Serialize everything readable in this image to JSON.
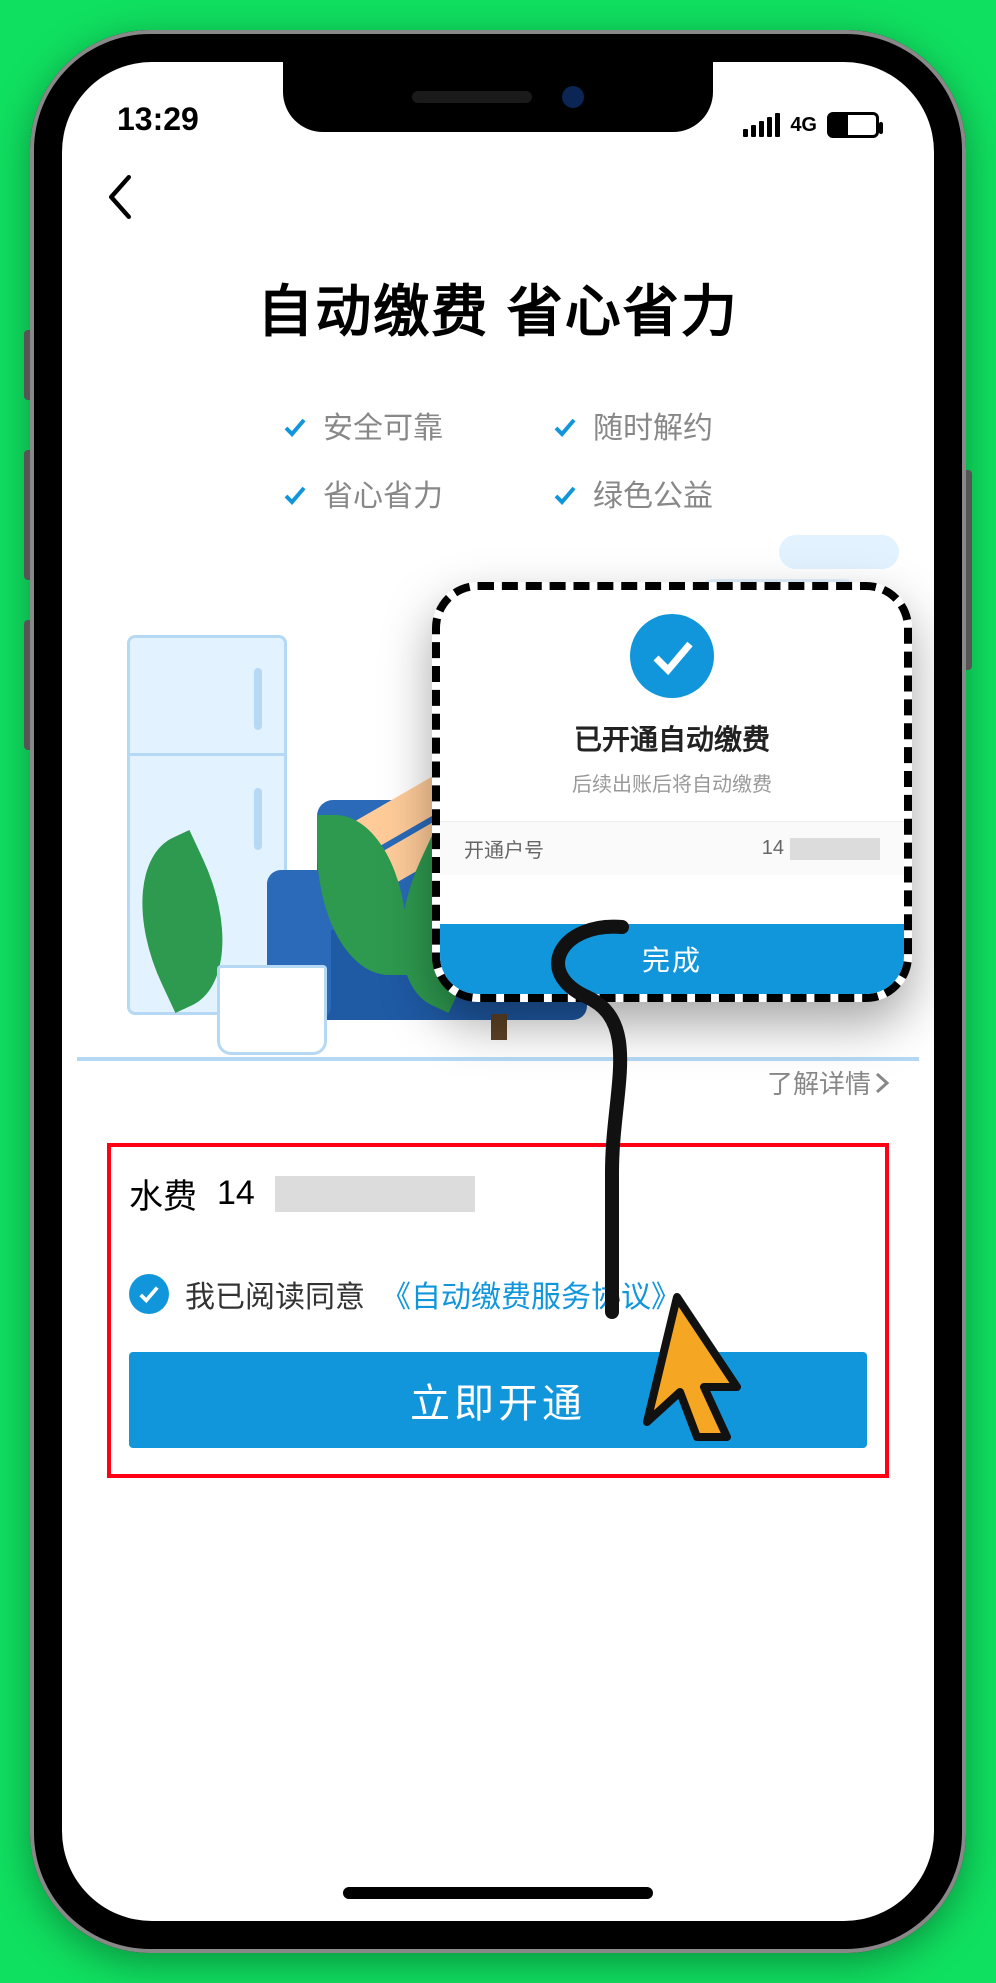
{
  "status": {
    "time": "13:29",
    "net": "4G"
  },
  "title": "自动缴费 省心省力",
  "features": [
    "安全可靠",
    "随时解约",
    "省心省力",
    "绿色公益"
  ],
  "learn_more": "了解详情",
  "bill": {
    "type": "水费",
    "acct_prefix": "14"
  },
  "agree": {
    "text": "我已阅读同意",
    "link": "《自动缴费服务协议》"
  },
  "cta": "立即开通",
  "popup": {
    "title": "已开通自动缴费",
    "subtitle": "后续出账后将自动缴费",
    "acct_label": "开通户号",
    "acct_prefix": "14",
    "done": "完成"
  }
}
